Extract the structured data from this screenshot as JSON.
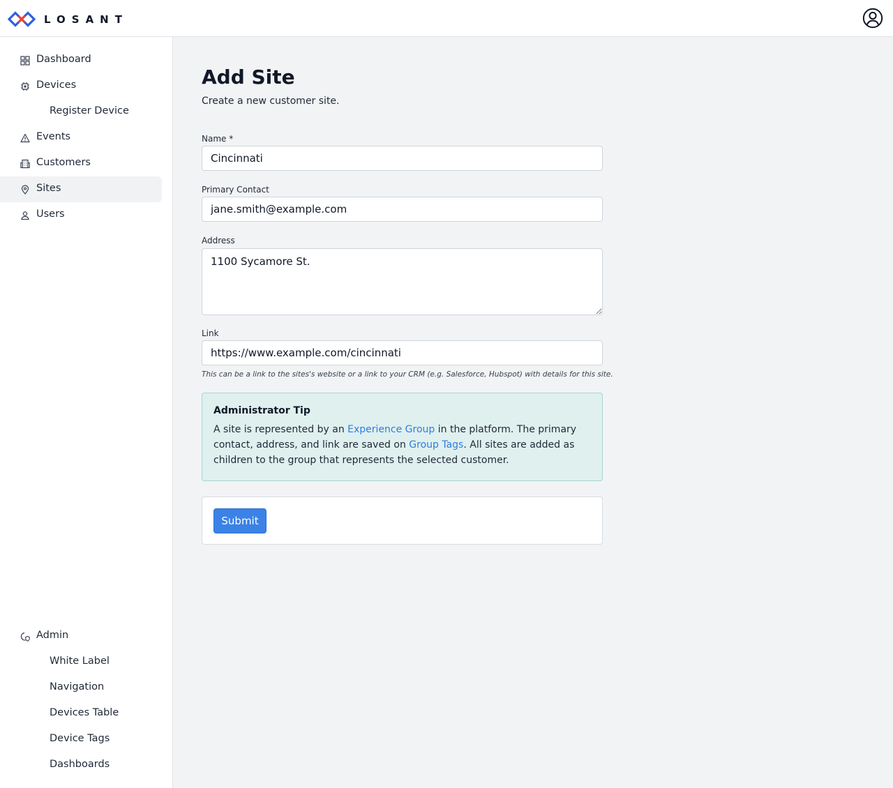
{
  "brand": {
    "name": "LOSANT"
  },
  "header": {
    "account_icon": "user-circle-icon"
  },
  "sidebar": {
    "items": [
      {
        "label": "Dashboard",
        "icon": "dashboard-grid-icon"
      },
      {
        "label": "Devices",
        "icon": "cpu-chip-icon"
      },
      {
        "label": "Register Device"
      },
      {
        "label": "Events",
        "icon": "warning-triangle-icon"
      },
      {
        "label": "Customers",
        "icon": "building-icon"
      },
      {
        "label": "Sites",
        "icon": "map-pin-icon",
        "active": true
      },
      {
        "label": "Users",
        "icon": "user-icon"
      }
    ],
    "admin": {
      "label": "Admin",
      "icon": "admin-shield-icon",
      "items": [
        {
          "label": "White Label"
        },
        {
          "label": "Navigation"
        },
        {
          "label": "Devices Table"
        },
        {
          "label": "Device Tags"
        },
        {
          "label": "Dashboards"
        }
      ]
    }
  },
  "page": {
    "title": "Add Site",
    "subtitle": "Create a new customer site."
  },
  "form": {
    "name": {
      "label": "Name *",
      "value": "Cincinnati"
    },
    "primary_contact": {
      "label": "Primary Contact",
      "value": "jane.smith@example.com"
    },
    "address": {
      "label": "Address",
      "value": "1100 Sycamore St."
    },
    "link": {
      "label": "Link",
      "value": "https://www.example.com/cincinnati",
      "help": "This can be a link to the sites's website or a link to your CRM (e.g. Salesforce, Hubspot) with details for this site."
    },
    "submit_label": "Submit"
  },
  "tip": {
    "title": "Administrator Tip",
    "text_1": "A site is represented by an ",
    "link_1": "Experience Group",
    "text_2": " in the platform. The primary contact, address, and link are saved on ",
    "link_2": "Group Tags",
    "text_3": ". All sites are added as children to the group that represents the selected customer."
  },
  "colors": {
    "accent": "#3b82e6",
    "link": "#2f7de1",
    "tip_bg": "#dff0ef",
    "tip_border": "#a6d6d0",
    "logo_blue": "#2f5fe0",
    "logo_red": "#e8463c"
  }
}
